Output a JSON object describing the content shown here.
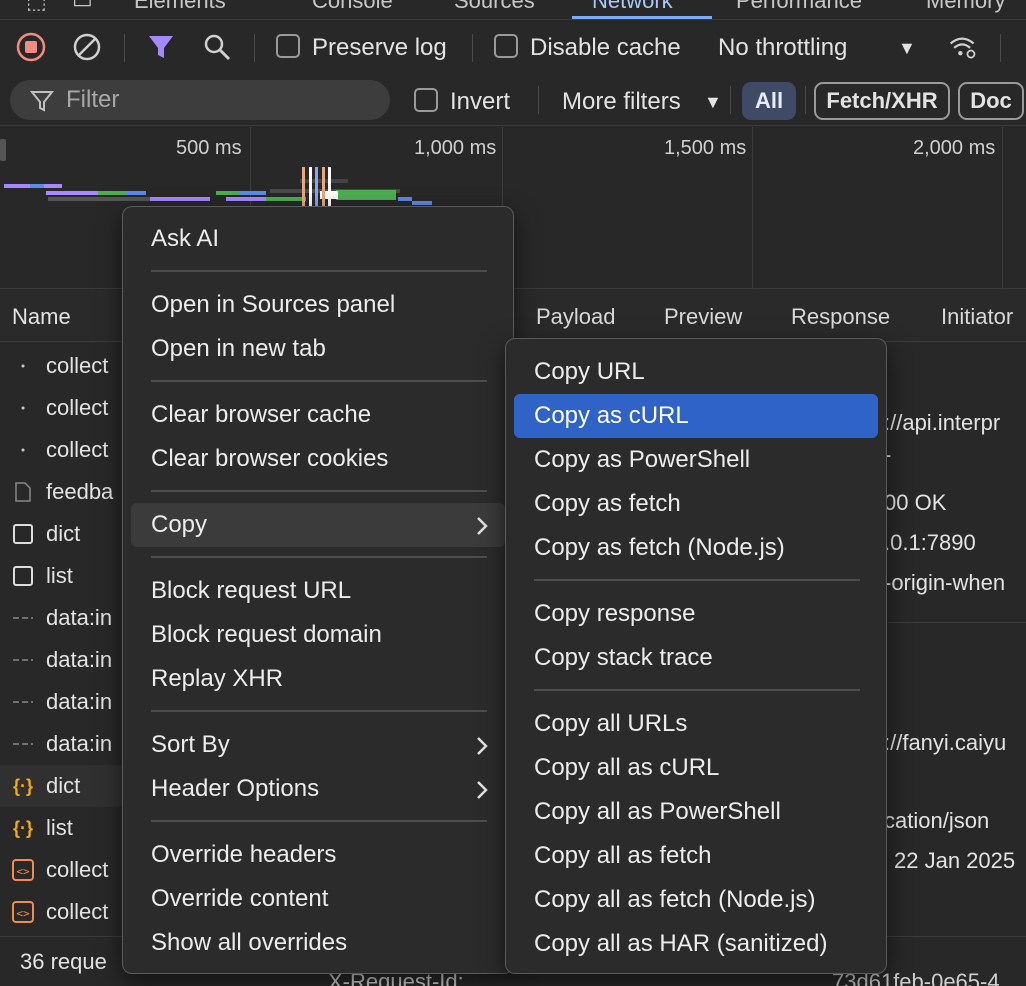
{
  "tabs": [
    "Elements",
    "Console",
    "Sources",
    "Network",
    "Performance",
    "Memory"
  ],
  "active_tab": "Network",
  "toolbar": {
    "preserve_log": "Preserve log",
    "disable_cache": "Disable cache",
    "throttling": "No throttling"
  },
  "filter": {
    "placeholder": "Filter",
    "invert": "Invert",
    "more_filters": "More filters",
    "chips": [
      "All",
      "Fetch/XHR",
      "Doc"
    ]
  },
  "overview": {
    "labels": [
      "500 ms",
      "1,000 ms",
      "1,500 ms",
      "2,000 ms"
    ]
  },
  "table_header": {
    "name": "Name",
    "detail_tabs": [
      "Payload",
      "Preview",
      "Response",
      "Initiator"
    ]
  },
  "requests": [
    {
      "name": "collect",
      "icon": "dot-icon"
    },
    {
      "name": "collect",
      "icon": "dot-icon"
    },
    {
      "name": "collect",
      "icon": "dot-icon"
    },
    {
      "name": "feedba",
      "icon": "document-icon"
    },
    {
      "name": "dict",
      "icon": "checkbox-icon"
    },
    {
      "name": "list",
      "icon": "checkbox-icon"
    },
    {
      "name": "data:in",
      "icon": "dash-icon"
    },
    {
      "name": "data:in",
      "icon": "dash-icon"
    },
    {
      "name": "data:in",
      "icon": "dash-icon"
    },
    {
      "name": "data:in",
      "icon": "dash-icon"
    },
    {
      "name": "dict",
      "icon": "braces-icon"
    },
    {
      "name": "list",
      "icon": "braces-icon"
    },
    {
      "name": "collect",
      "icon": "script-icon"
    },
    {
      "name": "collect",
      "icon": "script-icon"
    }
  ],
  "details": [
    "://api.interpr",
    "-",
    "00 OK",
    ".0.1:7890",
    "-origin-when",
    "://fanyi.caiyu",
    "cation/json",
    "22 Jan 2025",
    "n",
    "X-Request-Id:",
    "73d61feb-0e65-4"
  ],
  "status": {
    "requests": "36 reque"
  },
  "context_menu": {
    "items": [
      "Ask AI",
      "Open in Sources panel",
      "Open in new tab",
      "Clear browser cache",
      "Clear browser cookies",
      "Copy",
      "Block request URL",
      "Block request domain",
      "Replay XHR",
      "Sort By",
      "Header Options",
      "Override headers",
      "Override content",
      "Show all overrides"
    ]
  },
  "copy_submenu": {
    "items": [
      "Copy URL",
      "Copy as cURL",
      "Copy as PowerShell",
      "Copy as fetch",
      "Copy as fetch (Node.js)",
      "Copy response",
      "Copy stack trace",
      "Copy all URLs",
      "Copy all as cURL",
      "Copy all as PowerShell",
      "Copy all as fetch",
      "Copy all as fetch (Node.js)",
      "Copy all as HAR (sanitized)"
    ],
    "highlighted": "Copy as cURL"
  },
  "colors": {
    "accent": "#2f63c8",
    "record": "#f28b82",
    "filter_active": "#a688ff"
  }
}
